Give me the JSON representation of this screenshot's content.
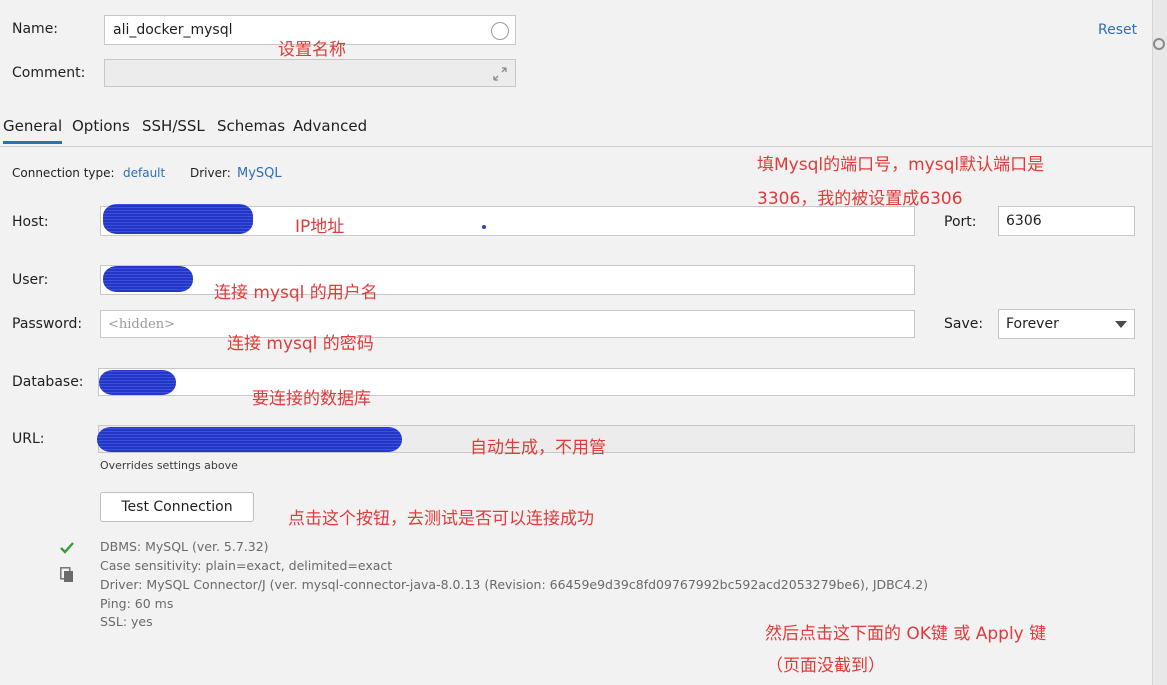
{
  "header": {
    "name_label": "Name:",
    "name_value": "ali_docker_mysql",
    "comment_label": "Comment:",
    "reset_label": "Reset"
  },
  "tabs": [
    "General",
    "Options",
    "SSH/SSL",
    "Schemas",
    "Advanced"
  ],
  "connection": {
    "type_label": "Connection type:",
    "type_value": "default",
    "driver_label": "Driver:",
    "driver_value": "MySQL"
  },
  "form": {
    "host_label": "Host:",
    "port_label": "Port:",
    "port_value": "6306",
    "user_label": "User:",
    "password_label": "Password:",
    "password_placeholder": "<hidden>",
    "save_label": "Save:",
    "save_value": "Forever",
    "database_label": "Database:",
    "url_label": "URL:",
    "url_hint": "Overrides settings above"
  },
  "test_button": "Test Connection",
  "status": {
    "dbms": "DBMS: MySQL (ver. 5.7.32)",
    "case": "Case sensitivity: plain=exact, delimited=exact",
    "driver": "Driver: MySQL Connector/J (ver. mysql-connector-java-8.0.13 (Revision: 66459e9d39c8fd09767992bc592acd2053279be6), JDBC4.2)",
    "ping": "Ping: 60 ms",
    "ssl": "SSL: yes"
  },
  "annotations": {
    "name": "设置名称",
    "port_line1": "填Mysql的端口号，mysql默认端口是",
    "port_line2": "3306，我的被设置成6306",
    "host": "IP地址",
    "user": "连接 mysql  的用户名",
    "password": "连接 mysql 的密码",
    "database": "要连接的数据库",
    "url": "自动生成，不用管",
    "test": "点击这个按钮，去测试是否可以连接成功",
    "bottom_line1": "然后点击这下面的 OK键 或 Apply 键",
    "bottom_line2": "（页面没截到）"
  },
  "icons": {
    "success": "check-icon",
    "copy": "copy-icon",
    "expand": "expand-icon",
    "dropdown": "chevron-down-icon"
  },
  "colors": {
    "accent": "#2f6fb3",
    "annotation": "#e03a3a",
    "success": "#3a9a3a"
  }
}
